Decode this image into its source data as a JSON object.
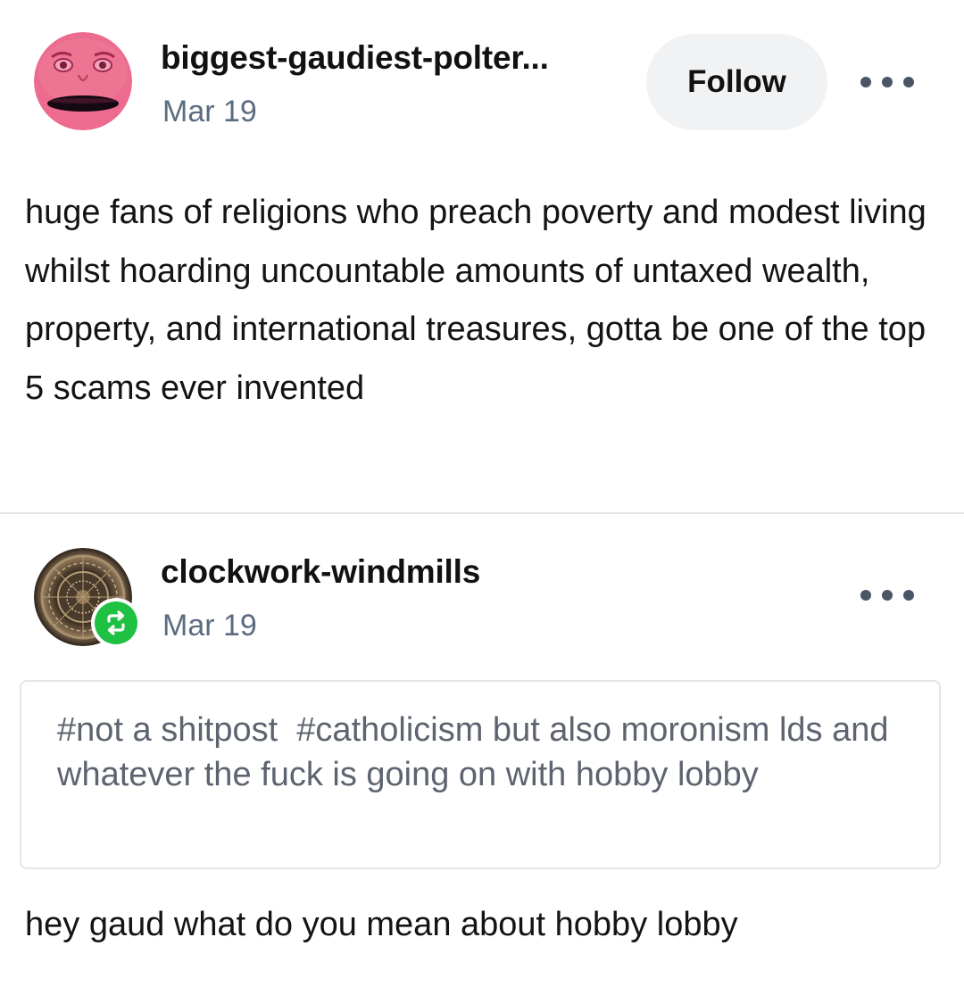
{
  "posts": [
    {
      "author": {
        "username": "biggest-gaudiest-polter...",
        "avatar_icon": "pink-face-avatar"
      },
      "date": "Mar 19",
      "follow_label": "Follow",
      "more_icon": "more-dots-icon",
      "body": "huge fans of religions who preach poverty and modest living whilst hoarding uncountable amounts of untaxed wealth, property, and international treasures, gotta be one of the top 5 scams ever invented"
    },
    {
      "author": {
        "username": "clockwork-windmills",
        "avatar_icon": "clock-ornament-avatar",
        "badge_icon": "reblog-icon"
      },
      "date": "Mar 19",
      "more_icon": "more-dots-icon",
      "tags": [
        "#not a shitpost",
        "#catholicism but also moronism lds and whatever the fuck is going on with hobby lobby"
      ],
      "body": "hey gaud what do you mean about hobby lobby"
    }
  ],
  "colors": {
    "accent_green": "#1ec142",
    "date_gray": "#5b6b80",
    "follow_bg": "#f1f2f4",
    "avatar_pink": "#ec6b8e"
  }
}
